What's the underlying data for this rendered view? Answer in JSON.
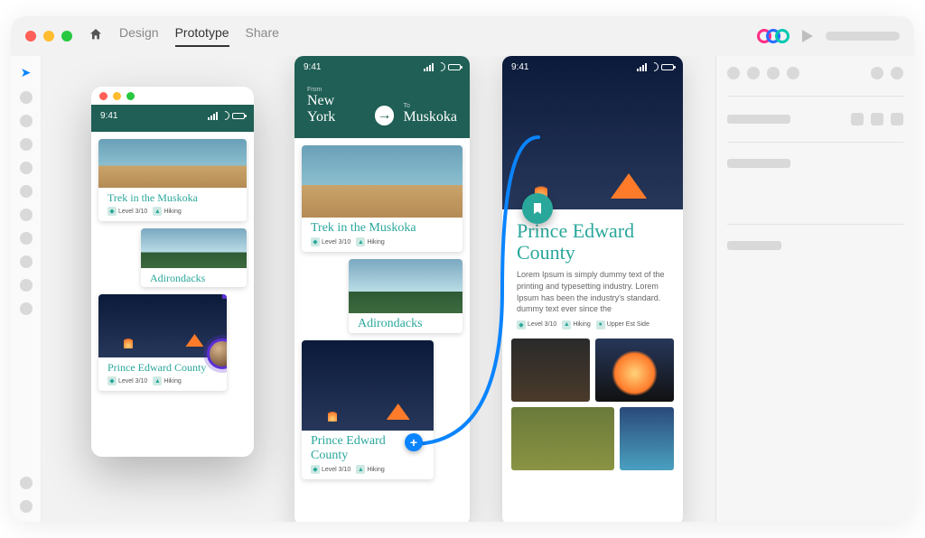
{
  "titlebar": {
    "tabs": [
      "Design",
      "Prototype",
      "Share"
    ],
    "active_tab": "Prototype"
  },
  "status": {
    "time": "9:41"
  },
  "route": {
    "from_label": "From",
    "from": "New York",
    "to_label": "To",
    "to": "Muskoka"
  },
  "cards": {
    "c1": {
      "title": "Trek in the Muskoka",
      "level": "Level 3/10",
      "tag": "Hiking"
    },
    "c2": {
      "title": "Adirondacks"
    },
    "c3": {
      "title": "Prince Edward County",
      "level": "Level 3/10",
      "tag": "Hiking"
    }
  },
  "detail": {
    "title": "Prince Edward County",
    "body": "Lorem Ipsum is simply dummy text of the printing and typesetting industry. Lorem Ipsum has been the industry's standard. dummy text ever since the",
    "level": "Level 3/10",
    "tag": "Hiking",
    "extra": "Upper Est Side"
  }
}
